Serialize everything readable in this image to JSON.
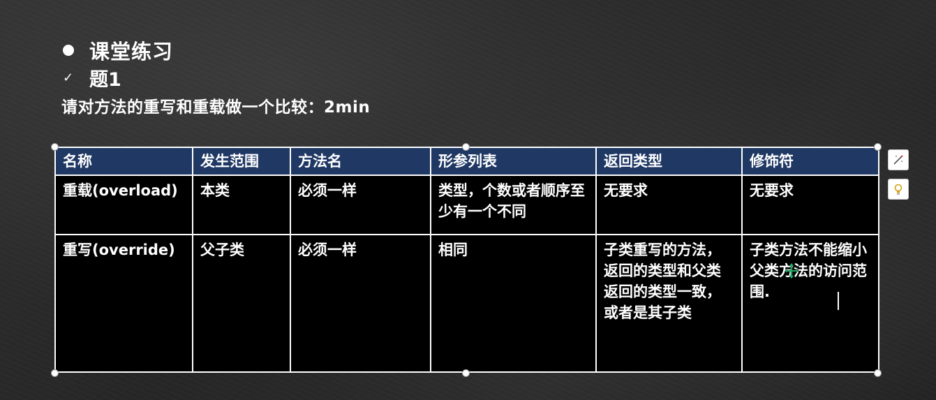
{
  "slide": {
    "bullet_title": "课堂练习",
    "check_symbol": "✓",
    "sub_title": "题1",
    "prompt": "请对方法的重写和重载做一个比较：2min"
  },
  "table": {
    "headers": [
      "名称",
      "发生范围",
      "方法名",
      "形参列表",
      "返回类型",
      "修饰符"
    ],
    "rows": [
      [
        "重载(overload)",
        "本类",
        "必须一样",
        "类型，个数或者顺序至少有一个不同",
        "无要求",
        "无要求"
      ],
      [
        "重写(override)",
        "父子类",
        "必须一样",
        "相同",
        "子类重写的方法，返回的类型和父类返回的类型一致，或者是其子类",
        "子类方法不能缩小父类方法的访问范围."
      ]
    ]
  },
  "side_tools": {
    "design_ideas_icon": "wand-icon",
    "tell_me_icon": "lightbulb-icon"
  },
  "colors": {
    "header_bg": "#1f3864",
    "table_bg": "#000000",
    "text": "#ffffff",
    "cursor_accent": "#2bb673"
  }
}
